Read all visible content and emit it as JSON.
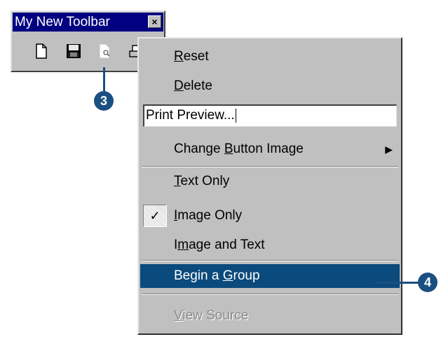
{
  "toolbar": {
    "title": "My New Toolbar",
    "close_glyph": "×",
    "tools": [
      "new-document-icon",
      "save-icon",
      "print-preview-icon",
      "print-icon"
    ]
  },
  "menu": {
    "reset": {
      "pre": "",
      "key": "R",
      "post": "eset"
    },
    "delete": {
      "pre": "",
      "key": "D",
      "post": "elete"
    },
    "name_value": "Print Preview...",
    "change_image": {
      "pre": "Change ",
      "key": "B",
      "post": "utton Image"
    },
    "submenu_arrow": "▶",
    "text_only": {
      "pre": "",
      "key": "T",
      "post": "ext Only"
    },
    "image_only": {
      "pre": "",
      "key": "I",
      "post": "mage Only"
    },
    "check_mark": "✓",
    "image_and_text": {
      "pre": "I",
      "key": "m",
      "post": "age and Text"
    },
    "begin_group": {
      "pre": "Begin a ",
      "key": "G",
      "post": "roup"
    },
    "view_source": {
      "pre": "",
      "key": "V",
      "post": "iew Source"
    }
  },
  "callouts": {
    "first": "3",
    "second": "4"
  },
  "colors": {
    "highlight": "#0b4a7c",
    "titlebar": "#000080",
    "callout": "#1a4f82",
    "menu_bg": "#c0c0c0"
  }
}
